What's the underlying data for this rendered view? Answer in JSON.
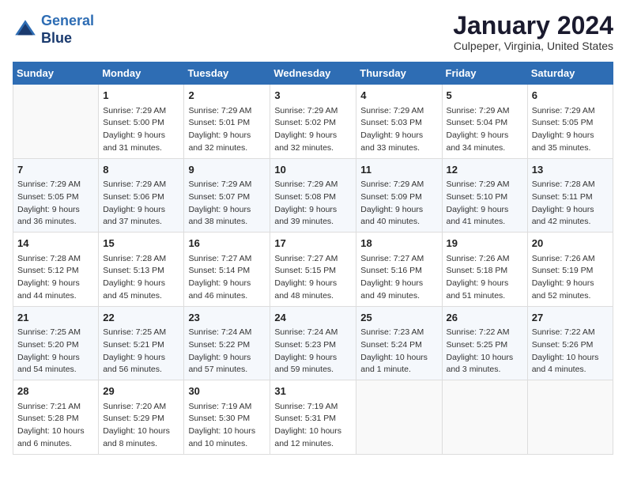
{
  "header": {
    "logo_line1": "General",
    "logo_line2": "Blue",
    "month_title": "January 2024",
    "location": "Culpeper, Virginia, United States"
  },
  "weekdays": [
    "Sunday",
    "Monday",
    "Tuesday",
    "Wednesday",
    "Thursday",
    "Friday",
    "Saturday"
  ],
  "weeks": [
    [
      {
        "day": "",
        "sunrise": "",
        "sunset": "",
        "daylight": ""
      },
      {
        "day": "1",
        "sunrise": "Sunrise: 7:29 AM",
        "sunset": "Sunset: 5:00 PM",
        "daylight": "Daylight: 9 hours and 31 minutes."
      },
      {
        "day": "2",
        "sunrise": "Sunrise: 7:29 AM",
        "sunset": "Sunset: 5:01 PM",
        "daylight": "Daylight: 9 hours and 32 minutes."
      },
      {
        "day": "3",
        "sunrise": "Sunrise: 7:29 AM",
        "sunset": "Sunset: 5:02 PM",
        "daylight": "Daylight: 9 hours and 32 minutes."
      },
      {
        "day": "4",
        "sunrise": "Sunrise: 7:29 AM",
        "sunset": "Sunset: 5:03 PM",
        "daylight": "Daylight: 9 hours and 33 minutes."
      },
      {
        "day": "5",
        "sunrise": "Sunrise: 7:29 AM",
        "sunset": "Sunset: 5:04 PM",
        "daylight": "Daylight: 9 hours and 34 minutes."
      },
      {
        "day": "6",
        "sunrise": "Sunrise: 7:29 AM",
        "sunset": "Sunset: 5:05 PM",
        "daylight": "Daylight: 9 hours and 35 minutes."
      }
    ],
    [
      {
        "day": "7",
        "sunrise": "Sunrise: 7:29 AM",
        "sunset": "Sunset: 5:05 PM",
        "daylight": "Daylight: 9 hours and 36 minutes."
      },
      {
        "day": "8",
        "sunrise": "Sunrise: 7:29 AM",
        "sunset": "Sunset: 5:06 PM",
        "daylight": "Daylight: 9 hours and 37 minutes."
      },
      {
        "day": "9",
        "sunrise": "Sunrise: 7:29 AM",
        "sunset": "Sunset: 5:07 PM",
        "daylight": "Daylight: 9 hours and 38 minutes."
      },
      {
        "day": "10",
        "sunrise": "Sunrise: 7:29 AM",
        "sunset": "Sunset: 5:08 PM",
        "daylight": "Daylight: 9 hours and 39 minutes."
      },
      {
        "day": "11",
        "sunrise": "Sunrise: 7:29 AM",
        "sunset": "Sunset: 5:09 PM",
        "daylight": "Daylight: 9 hours and 40 minutes."
      },
      {
        "day": "12",
        "sunrise": "Sunrise: 7:29 AM",
        "sunset": "Sunset: 5:10 PM",
        "daylight": "Daylight: 9 hours and 41 minutes."
      },
      {
        "day": "13",
        "sunrise": "Sunrise: 7:28 AM",
        "sunset": "Sunset: 5:11 PM",
        "daylight": "Daylight: 9 hours and 42 minutes."
      }
    ],
    [
      {
        "day": "14",
        "sunrise": "Sunrise: 7:28 AM",
        "sunset": "Sunset: 5:12 PM",
        "daylight": "Daylight: 9 hours and 44 minutes."
      },
      {
        "day": "15",
        "sunrise": "Sunrise: 7:28 AM",
        "sunset": "Sunset: 5:13 PM",
        "daylight": "Daylight: 9 hours and 45 minutes."
      },
      {
        "day": "16",
        "sunrise": "Sunrise: 7:27 AM",
        "sunset": "Sunset: 5:14 PM",
        "daylight": "Daylight: 9 hours and 46 minutes."
      },
      {
        "day": "17",
        "sunrise": "Sunrise: 7:27 AM",
        "sunset": "Sunset: 5:15 PM",
        "daylight": "Daylight: 9 hours and 48 minutes."
      },
      {
        "day": "18",
        "sunrise": "Sunrise: 7:27 AM",
        "sunset": "Sunset: 5:16 PM",
        "daylight": "Daylight: 9 hours and 49 minutes."
      },
      {
        "day": "19",
        "sunrise": "Sunrise: 7:26 AM",
        "sunset": "Sunset: 5:18 PM",
        "daylight": "Daylight: 9 hours and 51 minutes."
      },
      {
        "day": "20",
        "sunrise": "Sunrise: 7:26 AM",
        "sunset": "Sunset: 5:19 PM",
        "daylight": "Daylight: 9 hours and 52 minutes."
      }
    ],
    [
      {
        "day": "21",
        "sunrise": "Sunrise: 7:25 AM",
        "sunset": "Sunset: 5:20 PM",
        "daylight": "Daylight: 9 hours and 54 minutes."
      },
      {
        "day": "22",
        "sunrise": "Sunrise: 7:25 AM",
        "sunset": "Sunset: 5:21 PM",
        "daylight": "Daylight: 9 hours and 56 minutes."
      },
      {
        "day": "23",
        "sunrise": "Sunrise: 7:24 AM",
        "sunset": "Sunset: 5:22 PM",
        "daylight": "Daylight: 9 hours and 57 minutes."
      },
      {
        "day": "24",
        "sunrise": "Sunrise: 7:24 AM",
        "sunset": "Sunset: 5:23 PM",
        "daylight": "Daylight: 9 hours and 59 minutes."
      },
      {
        "day": "25",
        "sunrise": "Sunrise: 7:23 AM",
        "sunset": "Sunset: 5:24 PM",
        "daylight": "Daylight: 10 hours and 1 minute."
      },
      {
        "day": "26",
        "sunrise": "Sunrise: 7:22 AM",
        "sunset": "Sunset: 5:25 PM",
        "daylight": "Daylight: 10 hours and 3 minutes."
      },
      {
        "day": "27",
        "sunrise": "Sunrise: 7:22 AM",
        "sunset": "Sunset: 5:26 PM",
        "daylight": "Daylight: 10 hours and 4 minutes."
      }
    ],
    [
      {
        "day": "28",
        "sunrise": "Sunrise: 7:21 AM",
        "sunset": "Sunset: 5:28 PM",
        "daylight": "Daylight: 10 hours and 6 minutes."
      },
      {
        "day": "29",
        "sunrise": "Sunrise: 7:20 AM",
        "sunset": "Sunset: 5:29 PM",
        "daylight": "Daylight: 10 hours and 8 minutes."
      },
      {
        "day": "30",
        "sunrise": "Sunrise: 7:19 AM",
        "sunset": "Sunset: 5:30 PM",
        "daylight": "Daylight: 10 hours and 10 minutes."
      },
      {
        "day": "31",
        "sunrise": "Sunrise: 7:19 AM",
        "sunset": "Sunset: 5:31 PM",
        "daylight": "Daylight: 10 hours and 12 minutes."
      },
      {
        "day": "",
        "sunrise": "",
        "sunset": "",
        "daylight": ""
      },
      {
        "day": "",
        "sunrise": "",
        "sunset": "",
        "daylight": ""
      },
      {
        "day": "",
        "sunrise": "",
        "sunset": "",
        "daylight": ""
      }
    ]
  ]
}
